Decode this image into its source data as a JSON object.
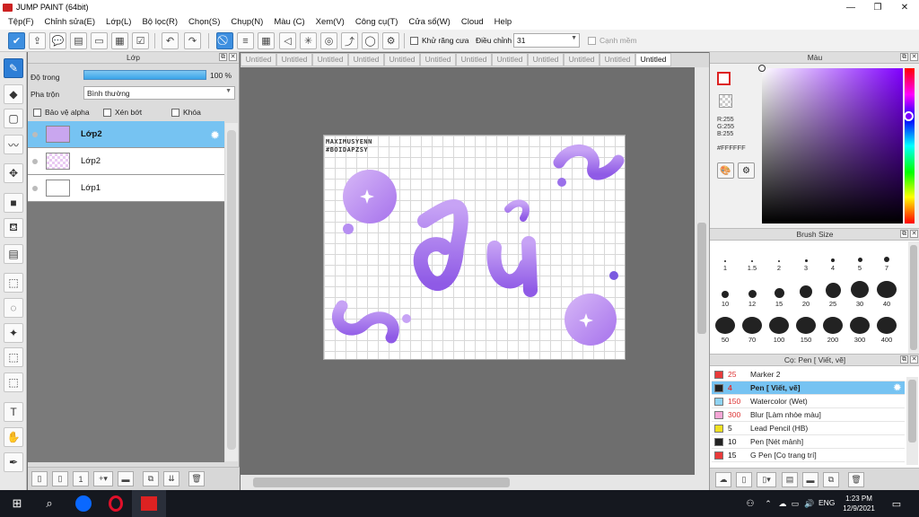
{
  "window": {
    "title": "JUMP PAINT (64bit)",
    "minimize": "—",
    "restore": "❐",
    "close": "✕"
  },
  "menu": [
    "Tệp(F)",
    "Chỉnh sửa(E)",
    "Lớp(L)",
    "Bộ lọc(R)",
    "Chọn(S)",
    "Chụp(N)",
    "Màu (C)",
    "Xem(V)",
    "Công cụ(T)",
    "Cửa sổ(W)",
    "Cloud",
    "Help"
  ],
  "toolbar": {
    "antialias_label": "Khử răng cưa",
    "adjust_label": "Điều chỉnh",
    "adjust_value": "31",
    "edge_smooth_label": "Cạnh mềm"
  },
  "layer_panel": {
    "title": "Lớp",
    "opacity_label": "Độ trong",
    "opacity_value": "100 %",
    "opacity_fraction": 1.0,
    "blend_label": "Pha trộn",
    "blend_value": "Bình thường",
    "protect_alpha": "Bảo vệ alpha",
    "clipping": "Xén bớt",
    "lock": "Khóa",
    "layers": [
      {
        "name": "Lớp2",
        "selected": true
      },
      {
        "name": "Lớp2",
        "selected": false
      },
      {
        "name": "Lớp1",
        "selected": false
      }
    ]
  },
  "tabs": [
    "Untitled",
    "Untitled",
    "Untitled",
    "Untitled",
    "Untitled",
    "Untitled",
    "Untitled",
    "Untitled",
    "Untitled",
    "Untitled",
    "Untitled",
    "Untitled"
  ],
  "canvas": {
    "signature": [
      "MAXIMUSYENN",
      "#BOIDAPZSY"
    ],
    "art_text": "đù"
  },
  "color_panel": {
    "title": "Màu",
    "rgb": [
      "R:255",
      "G:255",
      "B:255"
    ],
    "hex": "#FFFFFF"
  },
  "brush_size_panel": {
    "title": "Brush Size",
    "sizes": [
      "1",
      "1.5",
      "2",
      "3",
      "4",
      "5",
      "7",
      "10",
      "12",
      "15",
      "20",
      "25",
      "30",
      "40",
      "50",
      "70",
      "100",
      "150",
      "200",
      "300",
      "400"
    ]
  },
  "pen_panel": {
    "title": "Cọ: Pen [ Viết, vẽ]",
    "items": [
      {
        "size": "25",
        "name": "Marker 2",
        "color": "#e83a3a"
      },
      {
        "size": "4",
        "name": "Pen [ Viết, vẽ]",
        "color": "#222222",
        "selected": true
      },
      {
        "size": "150",
        "name": "Watercolor (Wet)",
        "color": "#8fd3f2"
      },
      {
        "size": "300",
        "name": "Blur [Làm nhòe màu]",
        "color": "#f5a6d6"
      },
      {
        "size": "5",
        "name": "Lead Pencil (HB)",
        "color": "#f0e020"
      },
      {
        "size": "10",
        "name": "Pen [Nét mảnh]",
        "color": "#222222"
      },
      {
        "size": "15",
        "name": "G Pen [Cọ trang trí]",
        "color": "#e83a3a"
      }
    ]
  },
  "taskbar": {
    "lang": "ENG",
    "time": "1:23 PM",
    "date": "12/9/2021"
  },
  "colors": {
    "accent": "#76c3f2",
    "art_purple": "#b07cf0"
  }
}
